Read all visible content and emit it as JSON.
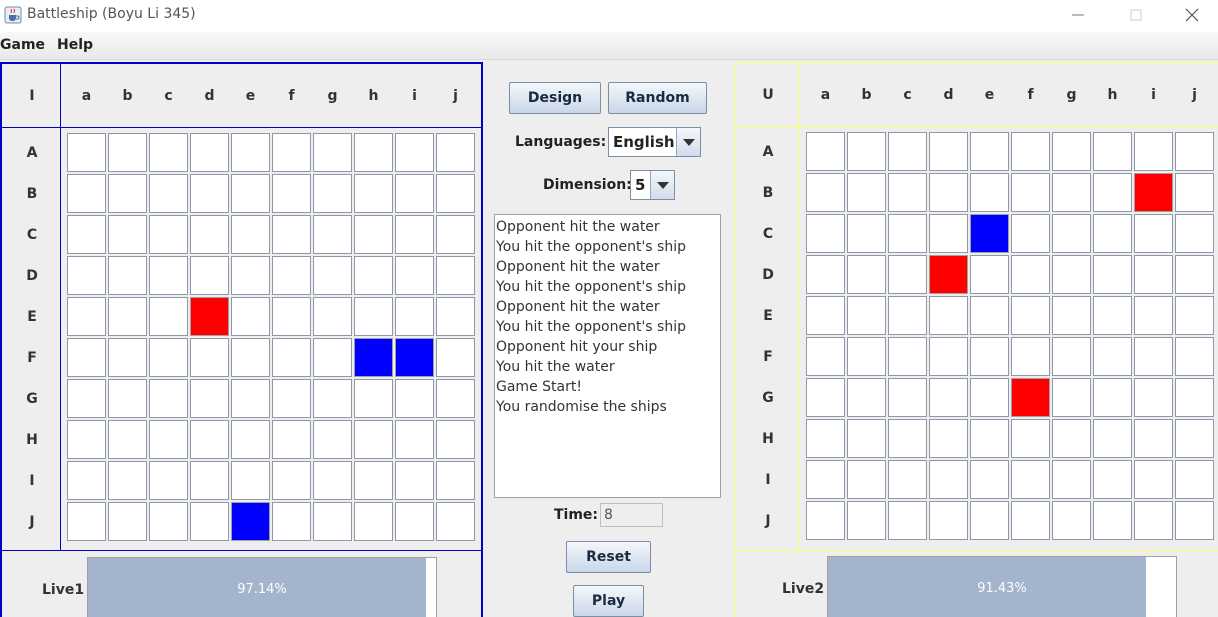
{
  "window": {
    "title": "Battleship (Boyu Li 345)"
  },
  "menu": {
    "game": "Game",
    "help": "Help"
  },
  "player_board": {
    "corner_label": "I",
    "columns": [
      "a",
      "b",
      "c",
      "d",
      "e",
      "f",
      "g",
      "h",
      "i",
      "j"
    ],
    "rows": [
      "A",
      "B",
      "C",
      "D",
      "E",
      "F",
      "G",
      "H",
      "I",
      "J"
    ],
    "hits": [
      [
        4,
        3
      ]
    ],
    "ships": [
      [
        5,
        7
      ],
      [
        5,
        8
      ],
      [
        9,
        4
      ]
    ],
    "live_label": "Live1",
    "live_percent": 97.14,
    "live_text": "97.14%",
    "border_color": "#0000c8"
  },
  "opponent_board": {
    "corner_label": "U",
    "columns": [
      "a",
      "b",
      "c",
      "d",
      "e",
      "f",
      "g",
      "h",
      "i",
      "j"
    ],
    "rows": [
      "A",
      "B",
      "C",
      "D",
      "E",
      "F",
      "G",
      "H",
      "I",
      "J"
    ],
    "hits": [
      [
        1,
        8
      ],
      [
        3,
        3
      ],
      [
        6,
        5
      ]
    ],
    "ships": [
      [
        2,
        4
      ]
    ],
    "live_label": "Live2",
    "live_percent": 91.43,
    "live_text": "91.43%",
    "border_color": "#ffff66"
  },
  "controls": {
    "design_label": "Design",
    "random_label": "Random",
    "languages_label": "Languages:",
    "language_value": "English",
    "dimension_label": "Dimension:",
    "dimension_value": "5",
    "time_label": "Time:",
    "time_value": "8",
    "reset_label": "Reset",
    "play_label": "Play"
  },
  "log": [
    "Opponent hit the water",
    "You hit the opponent's ship",
    "Opponent hit the water",
    "You hit the opponent's ship",
    "Opponent hit the water",
    "You hit the opponent's ship",
    "Opponent hit your ship",
    "You hit the water",
    "Game Start!",
    "You randomise the ships"
  ],
  "colors": {
    "hit": "#ff0000",
    "ship": "#0000ff",
    "live_fill": "#a3b4cc"
  },
  "icons": {
    "app": "java-cup-icon",
    "minimize": "minimize-icon",
    "maximize": "maximize-icon",
    "close": "close-icon",
    "dropdown": "chevron-down-icon"
  }
}
